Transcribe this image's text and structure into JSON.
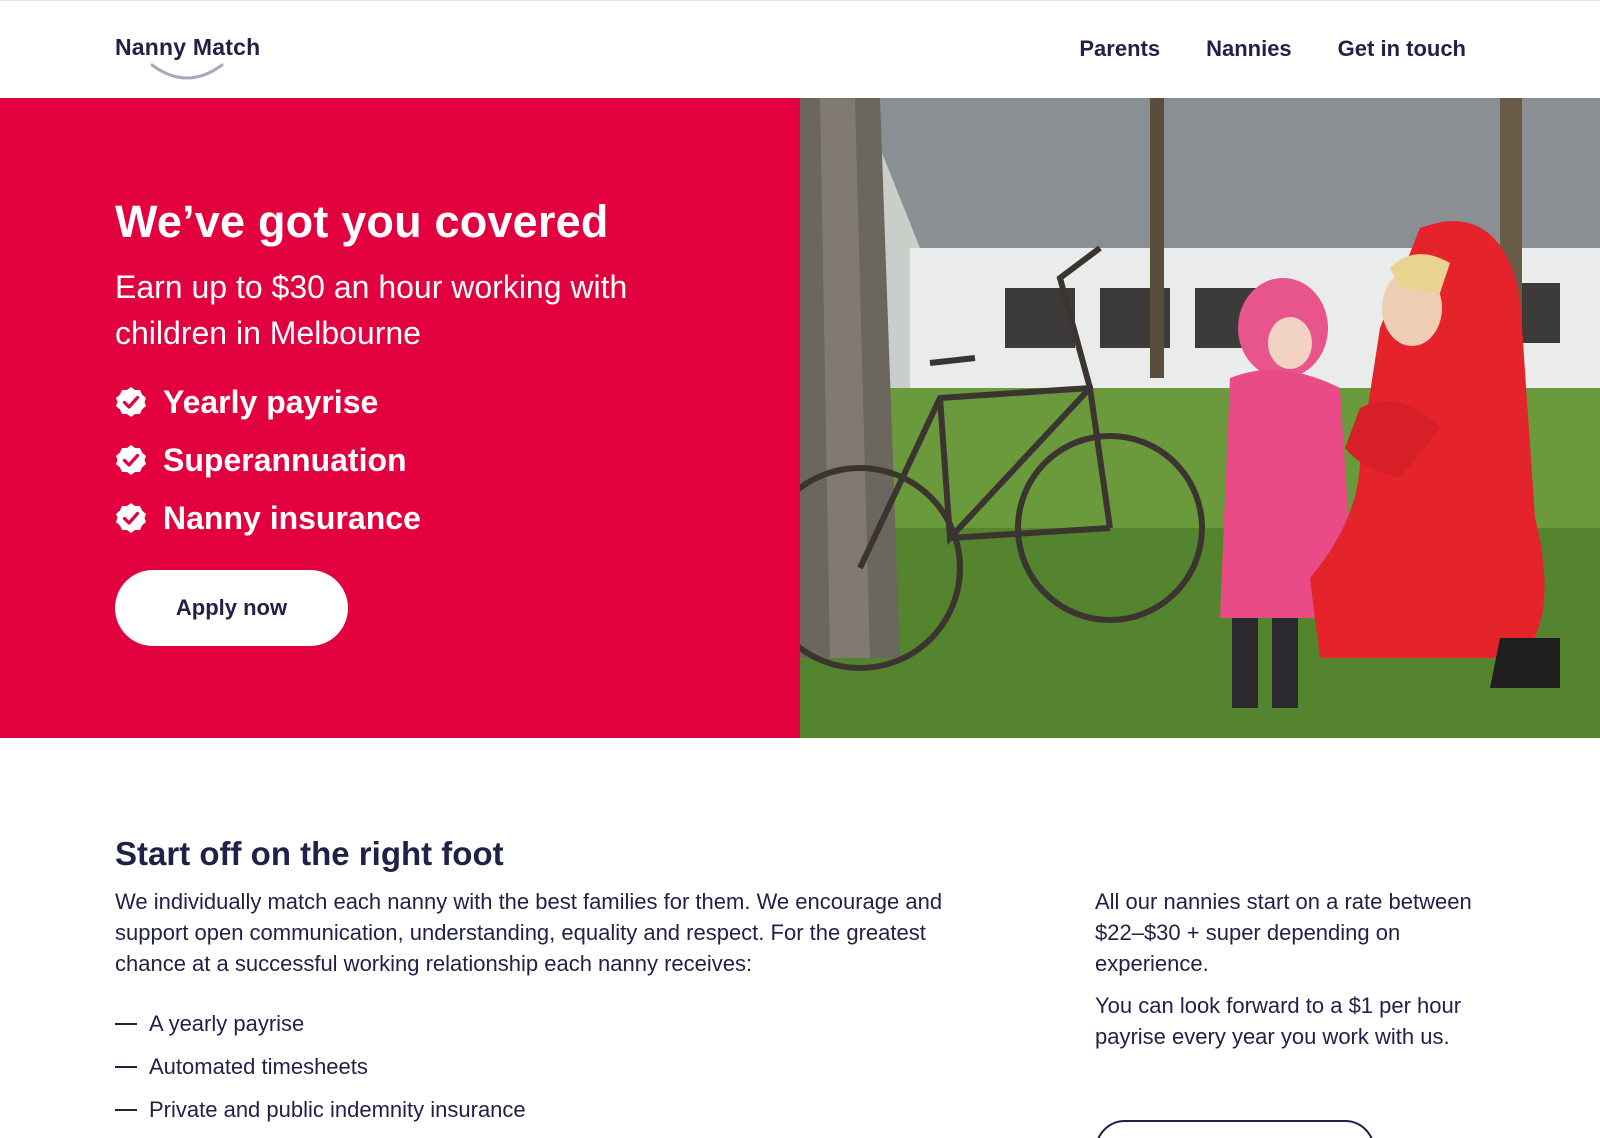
{
  "header": {
    "logo": "Nanny Match",
    "nav": [
      {
        "label": "Parents"
      },
      {
        "label": "Nannies"
      },
      {
        "label": "Get in touch"
      }
    ]
  },
  "hero": {
    "title": "We’ve got you covered",
    "subtitle": "Earn up to $30 an hour working with children in Melbourne",
    "benefits": [
      {
        "label": "Yearly payrise",
        "icon": "check-badge-icon"
      },
      {
        "label": "Superannuation",
        "icon": "check-badge-icon"
      },
      {
        "label": "Nanny insurance",
        "icon": "check-badge-icon"
      }
    ],
    "cta_label": "Apply now",
    "accent_color": "#e2003e",
    "text_color": "#1f2147"
  },
  "section": {
    "title": "Start off on the right foot",
    "body": "We individually match each nanny with the best families for them. We encourage and support open communication, understanding, equality and respect. For the greatest chance at a successful working relationship each nanny receives:",
    "list": [
      {
        "label": "A yearly payrise"
      },
      {
        "label": "Automated timesheets"
      },
      {
        "label": "Private and public indemnity insurance"
      }
    ],
    "side_paragraphs": [
      "All our nannies start on a rate between $22–$30 + super depending on experience.",
      "You can look forward to a $1 per hour payrise every year you work with us."
    ]
  }
}
